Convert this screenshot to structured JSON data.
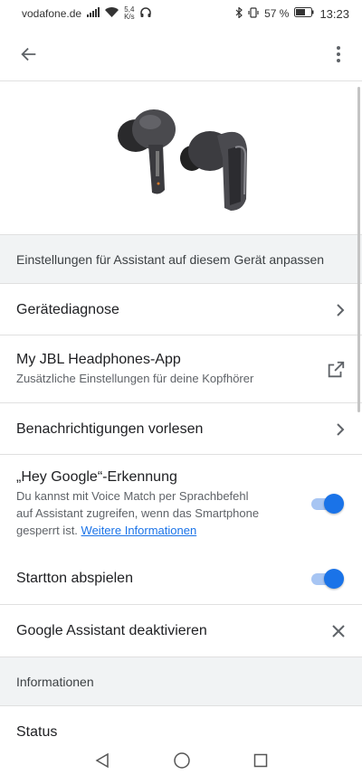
{
  "status_bar": {
    "carrier": "vodafone.de",
    "speed_value": "5,4",
    "speed_unit": "K/s",
    "battery": "57 %",
    "time": "13:23"
  },
  "app_bar": {
    "back_icon": "arrow-back-icon",
    "menu_icon": "more-vert-icon"
  },
  "hero": {
    "image": "jbl-earbuds-image"
  },
  "sections": {
    "assistant_settings": "Einstellungen für Assistant auf diesem Gerät anpassen",
    "info": "Informationen"
  },
  "rows": {
    "diagnostics": {
      "title": "Gerätediagnose",
      "icon": "chevron-right-icon"
    },
    "jbl_app": {
      "title": "My JBL Headphones-App",
      "subtitle": "Zusätzliche Einstellungen für deine Kopfhörer",
      "icon": "open-in-new-icon"
    },
    "notifications": {
      "title": "Benachrichtigungen vorlesen",
      "icon": "chevron-right-icon"
    },
    "hey_google": {
      "title": "„Hey Google“-Erkennung",
      "subtitle_line1": "Du kannst mit Voice Match per Sprachbefehl",
      "subtitle_line2": "auf Assistant zugreifen, wenn das Smartphone",
      "subtitle_line3": "gesperrt ist.",
      "link": "Weitere Informationen",
      "enabled": true
    },
    "start_tone": {
      "title": "Startton abspielen",
      "enabled": true
    },
    "deactivate": {
      "title": "Google Assistant deaktivieren",
      "icon": "close-icon"
    },
    "status": {
      "title": "Status"
    }
  },
  "nav_bar": {
    "back": "nav-back-icon",
    "home": "nav-home-icon",
    "recents": "nav-recents-icon"
  },
  "colors": {
    "accent": "#1a73e8",
    "track": "#a7c5f3",
    "section_bg": "#f1f3f4"
  }
}
